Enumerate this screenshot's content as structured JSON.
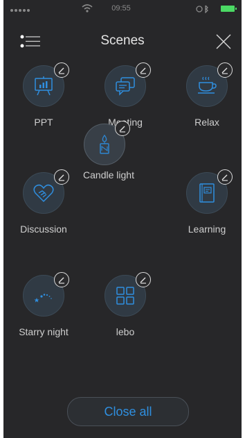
{
  "status_bar": {
    "time": "09:55",
    "icons": [
      "signal-dots-icon",
      "wifi-icon",
      "alarm-icon",
      "bluetooth-icon",
      "battery-icon"
    ]
  },
  "header": {
    "title": "Scenes",
    "menu_icon": "menu-list-icon",
    "close_icon": "close-icon"
  },
  "scenes": [
    {
      "label": "PPT",
      "icon": "presentation-board-icon"
    },
    {
      "label": "Meeting",
      "icon": "chat-bubbles-icon"
    },
    {
      "label": "Relax",
      "icon": "coffee-cup-icon"
    },
    {
      "label": "Discussion",
      "icon": "handshake-heart-icon"
    },
    {
      "label": "Learning",
      "icon": "book-icon"
    },
    {
      "label": "Starry night",
      "icon": "stars-icon"
    },
    {
      "label": "lebo",
      "icon": "grid-squares-icon"
    }
  ],
  "dragging_scene": {
    "label": "Candle light",
    "icon": "candle-icon"
  },
  "edit_icon": "edit-pencil-icon",
  "footer": {
    "close_all_label": "Close all"
  },
  "colors": {
    "background": "#272729",
    "accent": "#2f8fe0",
    "icon_circle": "#303a44",
    "text": "#cfcfcf",
    "battery": "#4bd964"
  }
}
